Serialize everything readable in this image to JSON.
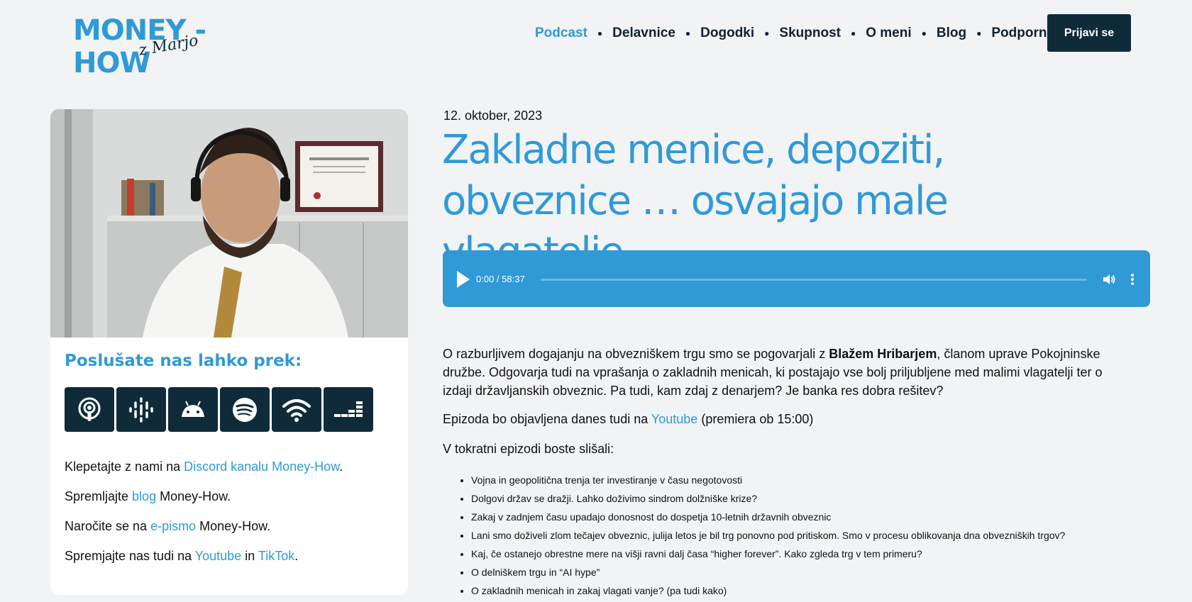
{
  "logo": {
    "text": "MONEY - HOW",
    "signature": "z Marjo"
  },
  "nav": {
    "items": [
      {
        "label": "Podcast",
        "active": true
      },
      {
        "label": "Delavnice"
      },
      {
        "label": "Dogodki"
      },
      {
        "label": "Skupnost"
      },
      {
        "label": "O meni"
      },
      {
        "label": "Blog"
      },
      {
        "label": "Podporniki"
      }
    ],
    "login_label": "Prijavi se"
  },
  "sidebar": {
    "listen_title": "Poslušate nas lahko prek:",
    "platform_icons": [
      "apple-podcasts-icon",
      "google-podcasts-icon",
      "android-icon",
      "spotify-icon",
      "rss-icon",
      "deezer-icon"
    ],
    "lines": [
      {
        "before": "Klepetajte z nami na ",
        "link": "Discord kanalu Money-How",
        "after": "."
      },
      {
        "before": "Spremljajte ",
        "link": "blog",
        "after": " Money-How."
      },
      {
        "before": "Naročite se na ",
        "link": "e-pismo",
        "after": " Money-How."
      },
      {
        "before": "Spremjajte nas tudi na ",
        "link": "Youtube",
        "middle": " in ",
        "link2": "TikTok",
        "after": "."
      }
    ]
  },
  "episode": {
    "date": "12. oktober, 2023",
    "title": "Zakladne menice, depoziti, obveznice … osvajajo male vlagatelje",
    "player": {
      "time": "0:00 / 58:37",
      "progress": 0
    },
    "intro_before": "O razburljivem dogajanju na obvezniškem trgu smo se pogovarjali z ",
    "intro_bold": "Blažem Hribarjem",
    "intro_after": ", članom uprave Pokojninske družbe. Odgovarja tudi na vprašanja o zakladnih menicah, ki postajajo vse bolj priljubljene med malimi vlagatelji ter o izdaji državljanskih obveznic. Pa tudi, kam zdaj z denarjem? Je banka res dobra rešitev?",
    "youtube_before": "Epizoda bo objavljena danes tudi na ",
    "youtube_link": "Youtube",
    "youtube_after": "  (premiera ob 15:00)",
    "topics_intro": "V tokratni epizodi boste slišali:",
    "topics": [
      "Vojna in geopolitična trenja ter investiranje v času negotovosti",
      "Dolgovi držav se dražji. Lahko doživimo sindrom dolžniške krize?",
      "Zakaj v zadnjem času upadajo donosnost do dospetja 10-letnih državnih obveznic",
      "Lani smo doživeli zlom tečajev obveznic, julija letos je bil trg ponovno pod pritiskom. Smo v procesu oblikovanja dna obvezniških trgov?",
      "Kaj, če ostanejo obrestne mere na višji ravni dalj časa “higher forever”. Kako zgleda trg v tem primeru?",
      "O delniškem trgu in “AI hype”",
      "O zakladnih menicah in zakaj vlagati vanje? (pa tudi kako)"
    ]
  },
  "colors": {
    "accent": "#2f9ad6",
    "dark": "#0f2b3a",
    "background": "#f2f3f5"
  }
}
